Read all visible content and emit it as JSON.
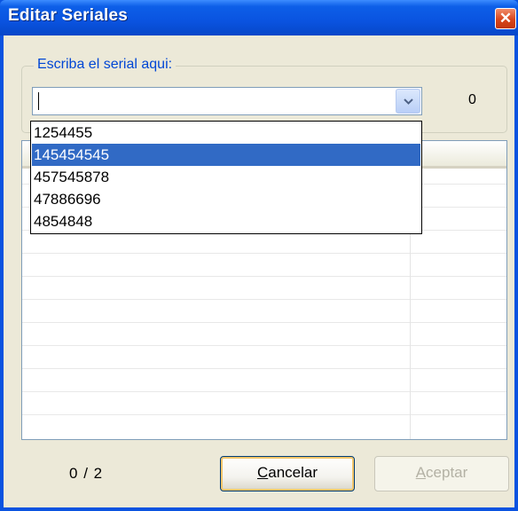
{
  "window": {
    "title": "Editar Seriales",
    "close_glyph": "✕"
  },
  "serial_group": {
    "label": "Escriba el serial aqui:"
  },
  "combo": {
    "value": "",
    "count": "0"
  },
  "dropdown": {
    "items": [
      "1254455",
      "145454545",
      "457545878",
      "47886696",
      "4854848"
    ],
    "selected_index": 1
  },
  "pager": {
    "current": "0",
    "separator": "/",
    "total": "2"
  },
  "buttons": {
    "cancel": {
      "mnemonic": "C",
      "rest": "ancelar"
    },
    "accept": {
      "mnemonic": "A",
      "rest": "ceptar"
    }
  },
  "icons": [
    "close-icon",
    "chevron-down-icon"
  ],
  "colors": {
    "title_blue": "#0a53e0",
    "selection": "#316ac5",
    "group_label": "#0046d5"
  }
}
